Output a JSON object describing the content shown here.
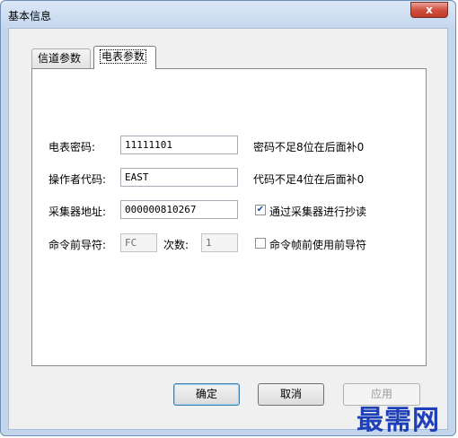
{
  "window": {
    "title": "基本信息",
    "close_glyph": "x"
  },
  "tabs": [
    {
      "label": "信道参数"
    },
    {
      "label": "电表参数"
    }
  ],
  "form": {
    "meter_password": {
      "label": "电表密码:",
      "value": "11111101",
      "hint": "密码不足8位在后面补0"
    },
    "operator_code": {
      "label": "操作者代码:",
      "value": "EAST",
      "hint": "代码不足4位在后面补0"
    },
    "collector_address": {
      "label": "采集器地址:",
      "value": "000000810267",
      "checkbox_label": "通过采集器进行抄读",
      "checked": true
    },
    "command_prefix": {
      "label": "命令前导符:",
      "value": "FC",
      "count_label": "次数:",
      "count_value": "1",
      "checkbox_label": "命令帧前使用前导符",
      "checked": false
    }
  },
  "buttons": {
    "ok": "确定",
    "cancel": "取消",
    "apply": "应用"
  },
  "watermark": "最需网",
  "colors": {
    "watermark": "#1d3fb8",
    "close_button": "#c03a26",
    "window_border": "#c4d6ec"
  }
}
